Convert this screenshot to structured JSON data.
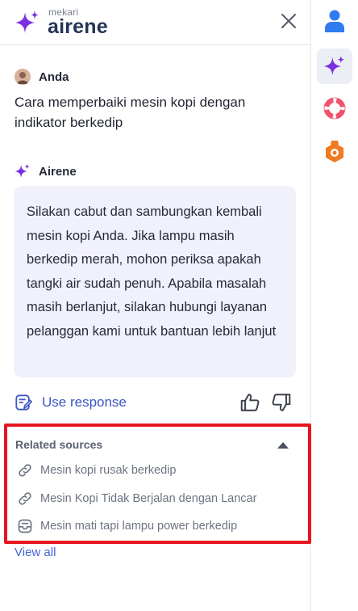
{
  "header": {
    "brand_small": "mekari",
    "brand_big": "airene",
    "close_icon": "close-icon"
  },
  "conversation": {
    "user": {
      "name": "Anda",
      "message": "Cara memperbaiki mesin kopi dengan indikator berkedip"
    },
    "assistant": {
      "name": "Airene",
      "message": "Silakan cabut dan sambungkan kembali mesin kopi Anda. Jika lampu masih berkedip merah, mohon periksa apakah tangki air sudah penuh. Apabila masalah masih berlanjut, silakan hubungi layanan pelanggan kami untuk bantuan lebih lanjut"
    }
  },
  "actions": {
    "use_response_label": "Use response",
    "thumbs_up_icon": "thumbs-up-icon",
    "thumbs_down_icon": "thumbs-down-icon"
  },
  "related_sources": {
    "title": "Related sources",
    "items": [
      {
        "label": "Mesin kopi rusak berkedip",
        "icon": "link-icon"
      },
      {
        "label": "Mesin Kopi Tidak Berjalan dengan Lancar",
        "icon": "link-icon"
      },
      {
        "label": "Mesin mati tapi lampu power berkedip",
        "icon": "inbox-icon"
      }
    ],
    "view_all_label": "View all"
  },
  "rail": {
    "items": [
      {
        "name": "profile",
        "icon": "person-icon",
        "active": false
      },
      {
        "name": "airene",
        "icon": "sparkle-icon",
        "active": true
      },
      {
        "name": "support",
        "icon": "lifebuoy-icon",
        "active": false
      },
      {
        "name": "badge",
        "icon": "badge-icon",
        "active": false
      }
    ]
  },
  "colors": {
    "accent_purple": "#7b2fe0",
    "link_blue": "#3d56c7",
    "highlight_red": "#e5161f",
    "bubble_bg": "#f0f1fb"
  }
}
